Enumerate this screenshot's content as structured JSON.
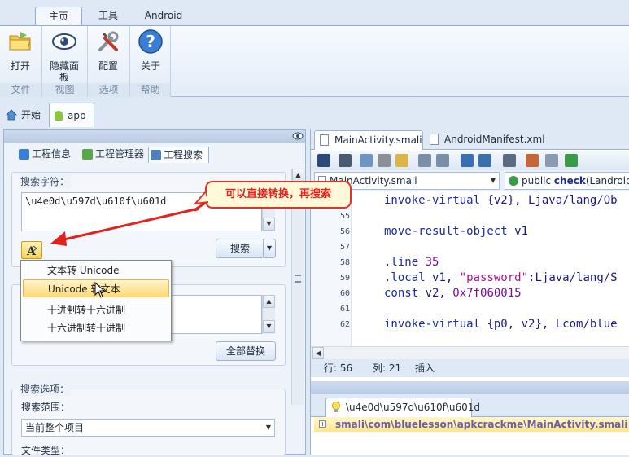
{
  "ribbon": {
    "tabs": [
      {
        "label": "主页",
        "active": true
      },
      {
        "label": "工具",
        "active": false
      },
      {
        "label": "Android",
        "active": false
      }
    ],
    "groups": [
      {
        "title": "文件",
        "buttons": [
          {
            "label": "打开",
            "icon": "folder-icon"
          }
        ]
      },
      {
        "title": "视图",
        "buttons": [
          {
            "label": "隐藏面板",
            "icon": "eye-icon"
          }
        ]
      },
      {
        "title": "选项",
        "buttons": [
          {
            "label": "配置",
            "icon": "tools-icon"
          }
        ]
      },
      {
        "title": "帮助",
        "buttons": [
          {
            "label": "关于",
            "icon": "help-icon"
          }
        ]
      }
    ]
  },
  "doc_tabs": [
    {
      "label": "开始",
      "icon": "home-icon",
      "active": false
    },
    {
      "label": "app",
      "icon": "android-icon",
      "active": true
    }
  ],
  "left_panel": {
    "tabs": [
      {
        "label": "工程信息",
        "icon": "info-icon",
        "active": false
      },
      {
        "label": "工程管理器",
        "icon": "tree-icon",
        "active": false
      },
      {
        "label": "工程搜索",
        "icon": "search-icon",
        "active": true
      }
    ],
    "search": {
      "section_title": "搜索字符：",
      "value": "\\u4e0d\\u597d\\u610f\\u601d",
      "search_button": "搜索"
    },
    "replace": {
      "replace_all_button": "全部替换"
    },
    "options": {
      "section_title": "搜索选项：",
      "scope_label": "搜索范围：",
      "scope_value": "当前整个项目",
      "filetype_label": "文件类型："
    }
  },
  "context_menu": {
    "items": [
      {
        "label": "文本转 Unicode",
        "highlighted": false
      },
      {
        "label": "Unicode 转文本",
        "highlighted": true
      },
      {
        "label": "十进制转十六进制",
        "highlighted": false
      },
      {
        "label": "十六进制转十进制",
        "highlighted": false
      }
    ]
  },
  "callout": {
    "text": "可以直接转换，再搜索"
  },
  "editor": {
    "tabs": [
      {
        "label": "MainActivity.smali",
        "active": true
      },
      {
        "label": "AndroidManifest.xml",
        "active": false
      }
    ],
    "file_combo": "MainActivity.smali",
    "method_combo_prefix": "public ",
    "method_combo_name": "check",
    "method_combo_suffix": "(Landroid",
    "lines": [
      {
        "num": "54",
        "parts": [
          [
            "kw",
            "invoke-virtual "
          ],
          [
            "reg",
            "{v2}, Ljava/lang/Ob"
          ]
        ]
      },
      {
        "num": "55",
        "parts": []
      },
      {
        "num": "56",
        "parts": [
          [
            "kw",
            "move-result-object "
          ],
          [
            "reg",
            "v1"
          ]
        ]
      },
      {
        "num": "57",
        "parts": []
      },
      {
        "num": "58",
        "parts": [
          [
            "kw",
            ".line "
          ],
          [
            "num",
            "35"
          ]
        ]
      },
      {
        "num": "59",
        "parts": [
          [
            "kw",
            ".local "
          ],
          [
            "reg",
            "v1, "
          ],
          [
            "str",
            "\"password\""
          ],
          [
            "reg",
            ":Ljava/lang/S"
          ]
        ]
      },
      {
        "num": "60",
        "parts": [
          [
            "kw",
            "const "
          ],
          [
            "reg",
            "v2, "
          ],
          [
            "num",
            "0x7f060015"
          ]
        ]
      },
      {
        "num": "61",
        "parts": []
      },
      {
        "num": "62",
        "parts": [
          [
            "kw",
            "invoke-virtual "
          ],
          [
            "reg",
            "{p0, v2}, Lcom/blue"
          ]
        ]
      }
    ],
    "status": {
      "row": "行: 56",
      "col": "列: 21",
      "mode": "插入"
    }
  },
  "results": {
    "tab_label": "\\u4e0d\\u597d\\u610f\\u601d",
    "row": "smali\\com\\bluelesson\\apkcrackme\\MainActivity.smali"
  }
}
